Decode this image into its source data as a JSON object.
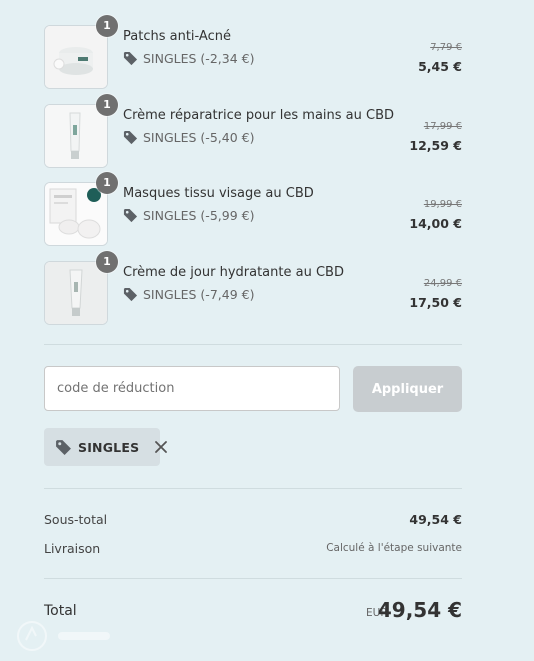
{
  "items": [
    {
      "name": "Patchs anti-Acné",
      "quantity": "1",
      "discount": "SINGLES (-2,34 €)",
      "old_price": "7,79 €",
      "price": "5,45 €"
    },
    {
      "name": "Crème réparatrice pour les mains au CBD",
      "quantity": "1",
      "discount": "SINGLES (-5,40 €)",
      "old_price": "17,99 €",
      "price": "12,59 €"
    },
    {
      "name": "Masques tissu visage au CBD",
      "quantity": "1",
      "discount": "SINGLES (-5,99 €)",
      "old_price": "19,99 €",
      "price": "14,00 €"
    },
    {
      "name": "Crème de jour hydratante au CBD",
      "quantity": "1",
      "discount": "SINGLES (-7,49 €)",
      "old_price": "24,99 €",
      "price": "17,50 €"
    }
  ],
  "discount_form": {
    "placeholder": "code de réduction",
    "value": "",
    "apply_label": "Appliquer"
  },
  "applied_code": {
    "label": "SINGLES"
  },
  "summary": {
    "subtotal_label": "Sous-total",
    "subtotal_value": "49,54 €",
    "shipping_label": "Livraison",
    "shipping_value": "Calculé à l'étape suivante"
  },
  "total": {
    "label": "Total",
    "currency": "EUR",
    "amount": "49,54 €"
  },
  "icons": {
    "tag": "tag-icon",
    "close": "close-icon"
  },
  "colors": {
    "background": "#e4f0f3",
    "quantity_badge": "#707070",
    "apply_button": "#c8cdd0",
    "chip": "#d6dfe3"
  }
}
